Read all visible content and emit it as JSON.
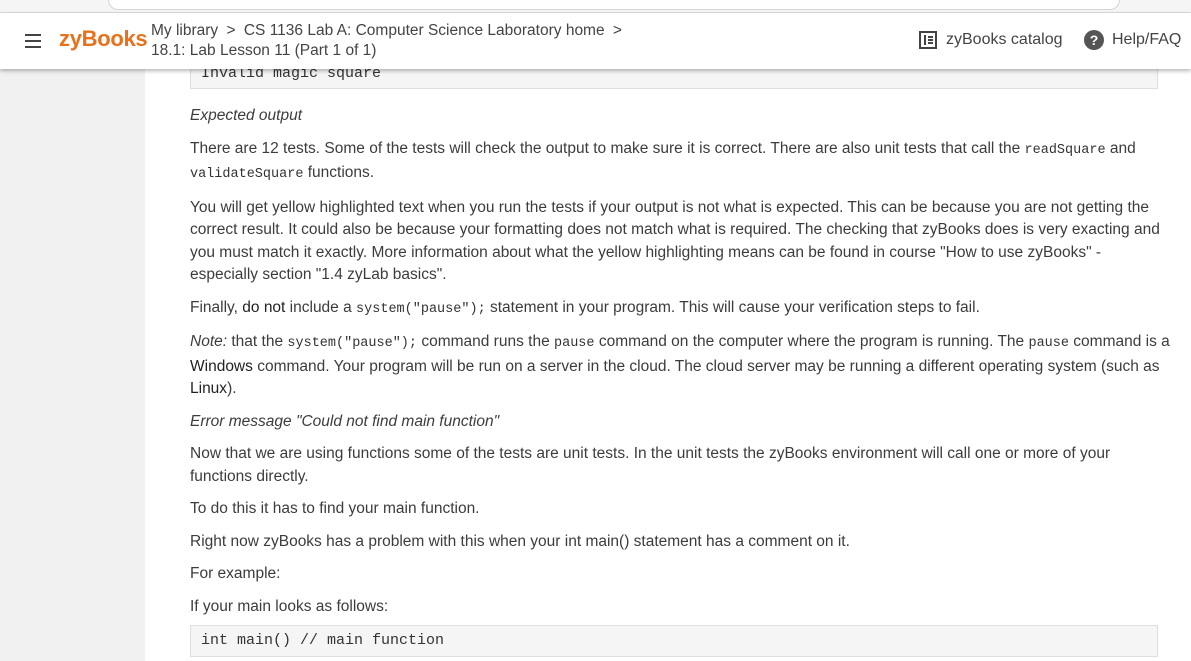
{
  "header": {
    "logo": "zyBooks",
    "breadcrumb": {
      "my_library": "My library",
      "sep": ">",
      "course": "CS 1136 Lab A: Computer Science Laboratory home",
      "section": "18.1: Lab Lesson 11 (Part 1 of 1)"
    },
    "catalog_label": "zyBooks catalog",
    "help_label": "Help/FAQ"
  },
  "content": {
    "code_top": "Invalid magic square",
    "expected_output_heading": "Expected output",
    "p1_a": "There are 12 tests. Some of the tests will check the output to make sure it is correct. There are also unit tests that call the ",
    "p1_code1": "readSquare",
    "p1_b": " and ",
    "p1_code2": "validateSquare",
    "p1_c": " functions.",
    "p2": "You will get yellow highlighted text when you run the tests if your output is not what is expected. This can be because you are not getting the correct result. It could also be because your formatting does not match what is required. The checking that zyBooks does is very exacting and you must match it exactly. More information about what the yellow highlighting means can be found in course \"How to use zyBooks\" - especially section \"1.4 zyLab basics\".",
    "p3_a": "Finally, ",
    "p3_bold": "do not",
    "p3_b": " include a ",
    "p3_code": "system(\"pause\");",
    "p3_c": " statement in your program. This will cause your verification steps to fail.",
    "p4_note": "Note:",
    "p4_a": " that the ",
    "p4_code1": "system(\"pause\");",
    "p4_b": " command runs the ",
    "p4_code2": "pause",
    "p4_c": " command on the computer where the program is running. The ",
    "p4_code3": "pause",
    "p4_d": " command is a ",
    "p4_windows": "Windows",
    "p4_e": " command. Your program will be run on a server in the cloud. The cloud server may be running a different operating system (such as ",
    "p4_linux": "Linux",
    "p4_f": ").",
    "error_heading": "Error message \"Could not find main function\"",
    "p5": "Now that we are using functions some of the tests are unit tests. In the unit tests the zyBooks environment will call one or more of your functions directly.",
    "p6": "To do this it has to find your main function.",
    "p7": "Right now zyBooks has a problem with this when your int main() statement has a comment on it.",
    "p8": "For example:",
    "p9": "If your main looks as follows:",
    "code_bottom": "int main() // main function"
  },
  "icons": {
    "menu": "hamburger-menu-icon",
    "catalog": "book-catalog-icon",
    "help": "question-circle-icon"
  },
  "colors": {
    "logo": "#e8721c",
    "page_bg": "#f1f1f1",
    "content_bg": "#ffffff",
    "code_bg": "#f5f5f5"
  }
}
